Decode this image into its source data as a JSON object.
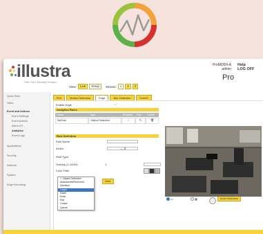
{
  "brand": {
    "name": "illustra",
    "tagline": "Flex Your Security Product"
  },
  "header": {
    "view_label": "View:",
    "view_options": [
      "Live",
      "Setup"
    ],
    "stream_label": "Stream:",
    "stream_options": [
      "1",
      "2",
      "3"
    ],
    "model": "ProMD5N-A",
    "user": "admin",
    "help": "Help",
    "logoff": "LOG OFF",
    "edition": "Pro"
  },
  "sidebar": {
    "items": [
      {
        "label": "Quick Start"
      },
      {
        "label": "Video"
      },
      {
        "label": "Event and Actions"
      },
      {
        "label": "Event Settings"
      },
      {
        "label": "Event Actions"
      },
      {
        "label": "Alarm I/O"
      },
      {
        "label": "Analytics"
      },
      {
        "label": "Event Logs"
      },
      {
        "label": "Applications"
      },
      {
        "label": "Security"
      },
      {
        "label": "Network"
      },
      {
        "label": "System"
      },
      {
        "label": "Edge Recording"
      }
    ]
  },
  "tabs": [
    "ROI",
    "Motion Detection",
    "Edge",
    "Blur Detection",
    "TrueVE"
  ],
  "enable_edge_label": "Enable Edge",
  "analytics_rules": {
    "title": "Analytics Rules",
    "columns": [
      "Name",
      "Type",
      "Enabled",
      "Edit",
      "Delete"
    ],
    "rows": [
      {
        "name": "MyRule",
        "type": "Object Detection"
      }
    ]
  },
  "rule_definition": {
    "title": "Rule Definition",
    "rule_name_label": "Rule Name",
    "action_label": "Action",
    "rule_type_label": "Rule Type",
    "overlap_label": "Overlap (1-100%)",
    "overlap_value": "1",
    "color_filter_label": "Color Filter",
    "save_label": "Save"
  },
  "rule_type_menu": {
    "options": [
      "Object Detection",
      "Abandoned/Removed",
      "Direction",
      "Linger",
      "Dwell",
      "Enter",
      "Exit",
      "Crowd",
      "Queue"
    ],
    "checked": "Object Detection",
    "highlighted": "Linger"
  },
  "draw_style": {
    "label": "Draw Style"
  },
  "draw_mode": {
    "label": "Draw Mode"
  },
  "side_buttons": [
    "Select All",
    "Deselect All",
    "Invert Selection"
  ],
  "colors": {
    "accent": "#f7d23a",
    "highlight": "#3b76c9",
    "sidebar_bg": "#f3f3f3"
  }
}
